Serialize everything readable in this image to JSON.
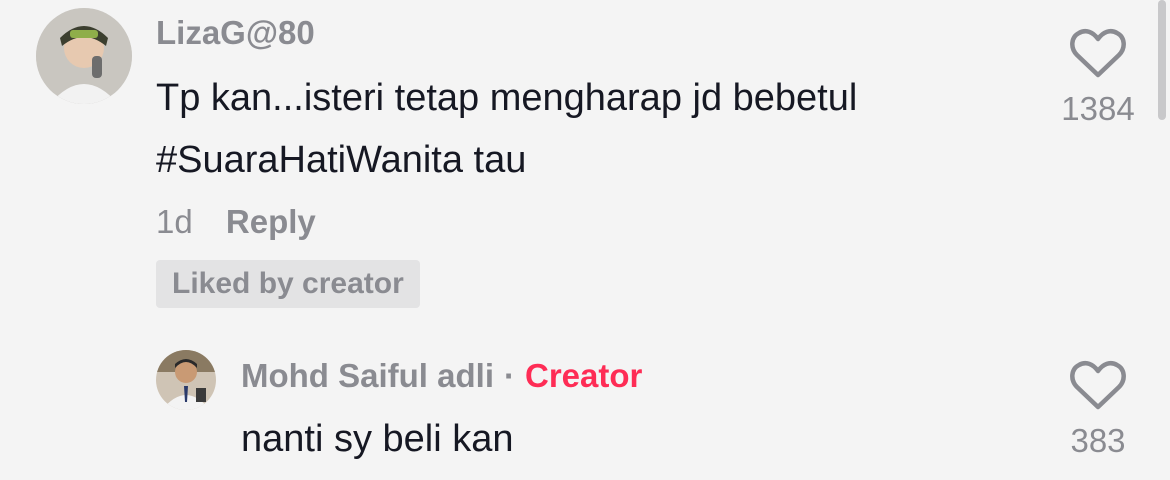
{
  "comment": {
    "username": "LizaG@80",
    "text_line1": "Tp kan...isteri tetap mengharap jd bebetul",
    "text_line2": "#SuaraHatiWanita tau",
    "time": "1d",
    "reply_label": "Reply",
    "liked_badge": "Liked by creator",
    "like_count": "1384"
  },
  "reply": {
    "username": "Mohd Saiful adli",
    "separator": "·",
    "creator_label": "Creator",
    "text": "nanti sy beli kan",
    "like_count": "383"
  },
  "icons": {
    "like": "heart-outline-icon"
  },
  "colors": {
    "creator": "#fe2c55",
    "muted": "#8a8b91",
    "text": "#161823"
  }
}
